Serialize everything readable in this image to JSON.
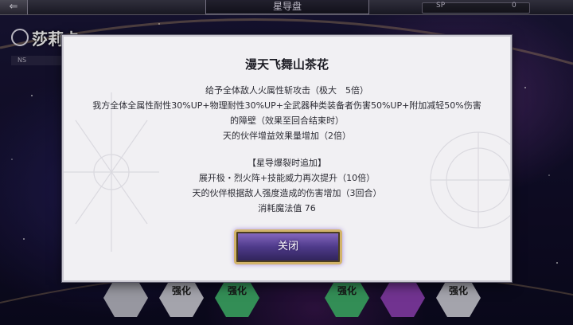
{
  "header": {
    "back_glyph": "⇐",
    "title": "星导盘",
    "sp_label": "SP",
    "sp_value": "0"
  },
  "character": {
    "name": "莎莉卡",
    "ns_label": "NS"
  },
  "background_buttons": {
    "label": "强化",
    "colors": [
      "#c9c9d2",
      "#3fae6a",
      "#3fae6a",
      "#8a3fb0",
      "#c9c9d2"
    ]
  },
  "dialog": {
    "title": "漫天飞舞山茶花",
    "lines": [
      "给予全体敌人火属性斩攻击（极大　5倍）",
      "我方全体全属性耐性30%UP+物理耐性30%UP+全武器种类装备者伤害50%UP+附加减轻50%伤害",
      "的障壁（效果至回合结束时）",
      "天的伙伴增益效果量增加（2倍）"
    ],
    "burst_lines": [
      "【星导爆裂时追加】",
      "展开极・烈火阵+技能威力再次提升（10倍）",
      "天的伙伴根据敌人强度造成的伤害增加（3回合）",
      "消耗魔法值 76"
    ],
    "close_label": "关闭"
  },
  "colors": {
    "dialog_bg": "#f1f0f3",
    "button_purple": "#4e3a8a",
    "button_gold_border": "#d2b46a"
  }
}
